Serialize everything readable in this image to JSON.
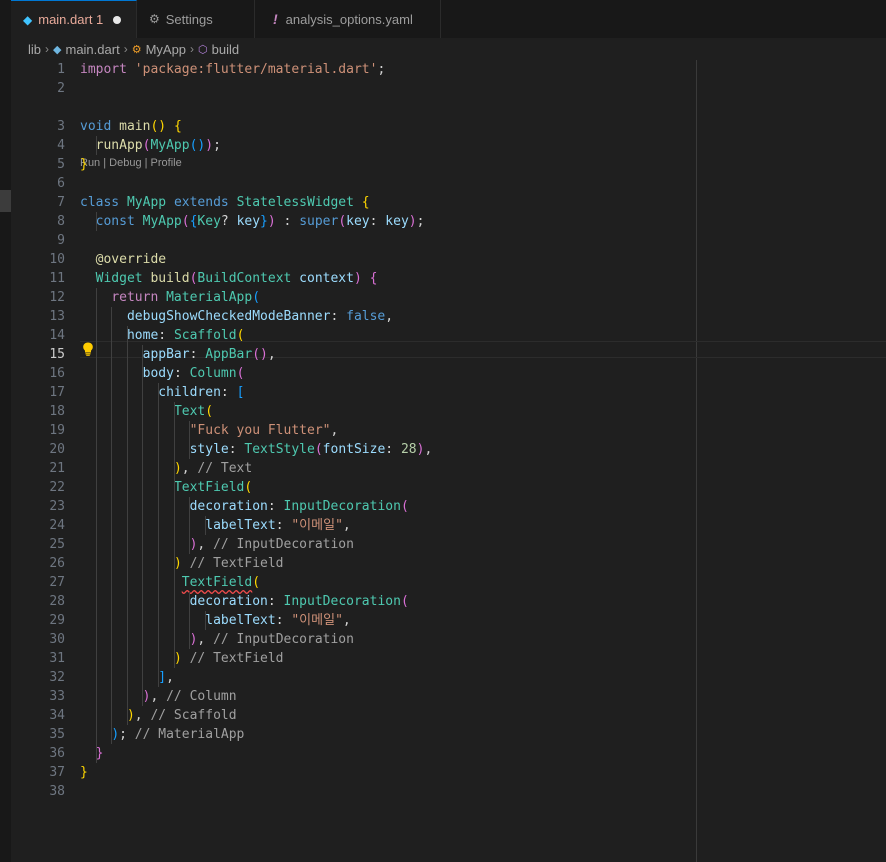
{
  "tabs": [
    {
      "label": "main.dart 1",
      "icon": "dart-icon",
      "active": true,
      "modified": true
    },
    {
      "label": "Settings",
      "icon": "settings-icon",
      "active": false
    },
    {
      "label": "analysis_options.yaml",
      "icon": "exclamation-icon",
      "active": false
    }
  ],
  "breadcrumb": [
    "lib",
    "main.dart",
    "MyApp",
    "build"
  ],
  "codelens": "Run | Debug | Profile",
  "current_line": 15,
  "lines": [
    {
      "n": "1",
      "code": "import 'package:flutter/material.dart';"
    },
    {
      "n": "2",
      "code": ""
    },
    {
      "n": "3",
      "code": "void main() {"
    },
    {
      "n": "4",
      "code": "  runApp(MyApp());"
    },
    {
      "n": "5",
      "code": "}"
    },
    {
      "n": "6",
      "code": ""
    },
    {
      "n": "7",
      "code": "class MyApp extends StatelessWidget {"
    },
    {
      "n": "8",
      "code": "  const MyApp({Key? key}) : super(key: key);"
    },
    {
      "n": "9",
      "code": ""
    },
    {
      "n": "10",
      "code": "  @override"
    },
    {
      "n": "11",
      "code": "  Widget build(BuildContext context) {"
    },
    {
      "n": "12",
      "code": "    return MaterialApp("
    },
    {
      "n": "13",
      "code": "      debugShowCheckedModeBanner: false,"
    },
    {
      "n": "14",
      "code": "      home: Scaffold("
    },
    {
      "n": "15",
      "code": "        appBar: AppBar(),"
    },
    {
      "n": "16",
      "code": "        body: Column("
    },
    {
      "n": "17",
      "code": "          children: ["
    },
    {
      "n": "18",
      "code": "            Text("
    },
    {
      "n": "19",
      "code": "              \"Fuck you Flutter\","
    },
    {
      "n": "20",
      "code": "              style: TextStyle(fontSize: 28),"
    },
    {
      "n": "21",
      "code": "            ), // Text"
    },
    {
      "n": "22",
      "code": "            TextField("
    },
    {
      "n": "23",
      "code": "              decoration: InputDecoration("
    },
    {
      "n": "24",
      "code": "                labelText: \"이메일\","
    },
    {
      "n": "25",
      "code": "              ), // InputDecoration"
    },
    {
      "n": "26",
      "code": "            ) // TextField"
    },
    {
      "n": "27",
      "code": "             TextField("
    },
    {
      "n": "28",
      "code": "              decoration: InputDecoration("
    },
    {
      "n": "29",
      "code": "                labelText: \"이메일\","
    },
    {
      "n": "30",
      "code": "              ), // InputDecoration"
    },
    {
      "n": "31",
      "code": "            ) // TextField"
    },
    {
      "n": "32",
      "code": "          ],"
    },
    {
      "n": "33",
      "code": "        ), // Column"
    },
    {
      "n": "34",
      "code": "      ), // Scaffold"
    },
    {
      "n": "35",
      "code": "    ); // MaterialApp"
    },
    {
      "n": "36",
      "code": "  }"
    },
    {
      "n": "37",
      "code": "}"
    },
    {
      "n": "38",
      "code": ""
    }
  ],
  "colors": {
    "accent": "#0078d4",
    "editor_bg": "#1f1f1f",
    "modified_tab_text": "#e8aa9a",
    "error_squiggle": "#f14c4c",
    "lightbulb": "#ffcc00"
  }
}
